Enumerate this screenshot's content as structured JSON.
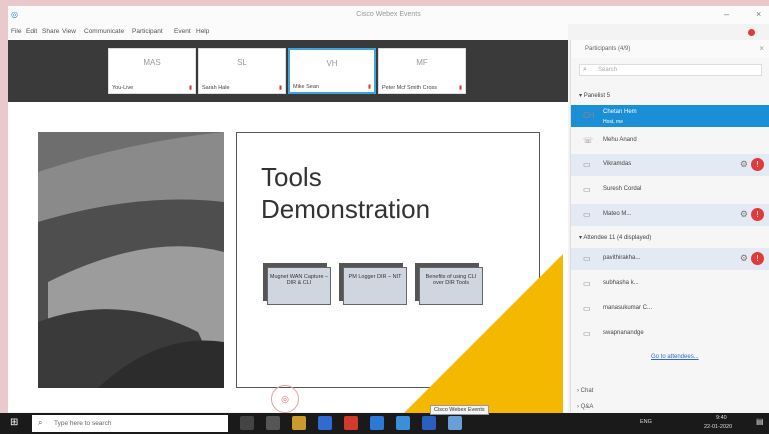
{
  "window": {
    "title": "Cisco Webex Events",
    "menu": [
      "File",
      "Edit",
      "Share",
      "View",
      "Communicate",
      "Participant",
      "Event",
      "Help"
    ]
  },
  "video_strip": [
    {
      "initials": "MAS",
      "name": "You-Live",
      "active": false
    },
    {
      "initials": "SL",
      "name": "Sarah Hale",
      "active": false
    },
    {
      "initials": "VH",
      "name": "Mike Sean",
      "active": true
    },
    {
      "initials": "MF",
      "name": "Peter Mcf Smith Cross",
      "active": false
    }
  ],
  "slide": {
    "title_line1": "Tools",
    "title_line2": "Demonstration",
    "boxes": [
      "Mugnet WAN Capture – DIR & CLI",
      "PM Logger DIR – NIT",
      "Benefits of using CLI over DIR Tools"
    ],
    "accent_color": "#f5b800"
  },
  "participants": {
    "header": "Participants (4/9)",
    "search_placeholder": "Search",
    "panelists_label": "Panelist 5",
    "attendees_label": "Attendee 11 (4 displayed)",
    "panelists": [
      {
        "avatar": "CH",
        "name": "Chetan Hem",
        "sub": "Host, me",
        "me": true,
        "highlight": false,
        "lw": false
      },
      {
        "avatar": "☏",
        "name": "Mehu Anand",
        "sub": "",
        "me": false,
        "highlight": false,
        "lw": false
      },
      {
        "avatar": "▭",
        "name": "Vikramdas",
        "sub": "",
        "me": false,
        "highlight": true,
        "lw": true
      },
      {
        "avatar": "▭",
        "name": "Suresh Cordal",
        "sub": "",
        "me": false,
        "highlight": false,
        "lw": false
      },
      {
        "avatar": "▭",
        "name": "Mateo M...",
        "sub": "",
        "me": false,
        "highlight": true,
        "lw": true
      }
    ],
    "attendees": [
      {
        "avatar": "▭",
        "name": "pavithirakha...",
        "highlight": true,
        "lw": true
      },
      {
        "avatar": "▭",
        "name": "subhasha k...",
        "highlight": false,
        "lw": false
      },
      {
        "avatar": "▭",
        "name": "manasukumar C...",
        "highlight": false,
        "lw": false
      },
      {
        "avatar": "▭",
        "name": "swapnanandge",
        "highlight": false,
        "lw": false
      }
    ],
    "show_all": "Go to attendees...",
    "chat": "Chat",
    "qa": "Q&A"
  },
  "taskbar": {
    "search_text": "Type here to search",
    "tooltip": "Cisco Webex Events",
    "time": "9:40",
    "date": "22-01-2020",
    "lang": "ENG"
  }
}
